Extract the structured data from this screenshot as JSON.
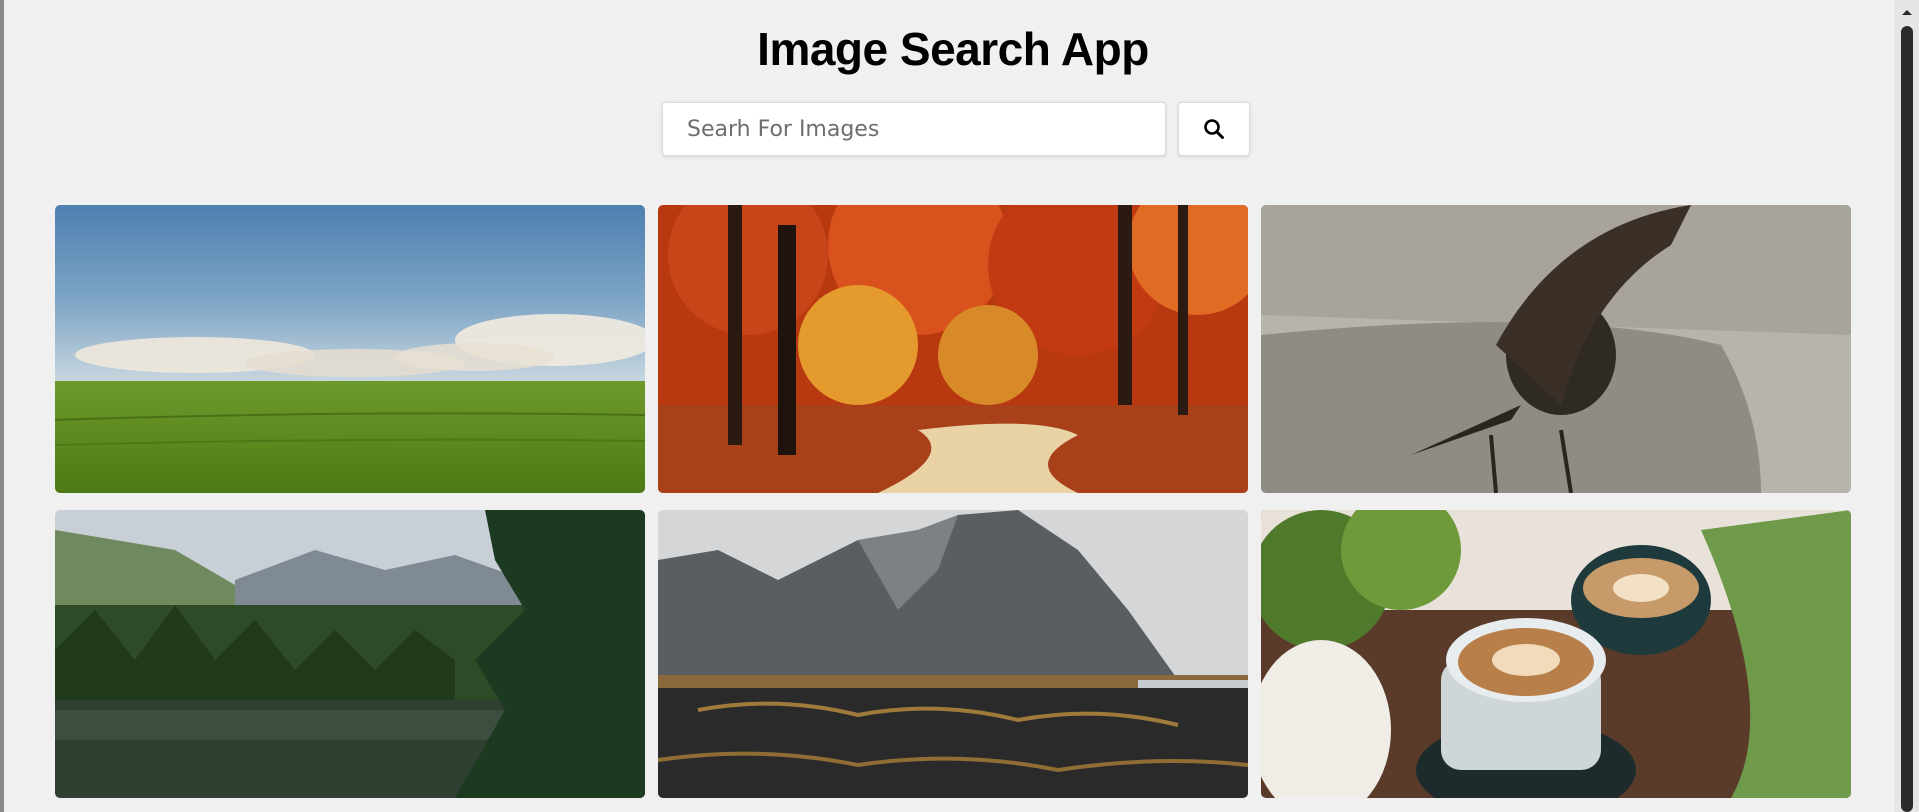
{
  "app": {
    "title": "Image Search App"
  },
  "search": {
    "placeholder": "Searh For Images",
    "value": "",
    "button_icon": "search-icon"
  },
  "results": [
    {
      "icon": "green-field-image"
    },
    {
      "icon": "autumn-forest-path-image"
    },
    {
      "icon": "starling-bird-image"
    },
    {
      "icon": "mountain-lake-forest-image"
    },
    {
      "icon": "black-sand-mountain-image"
    },
    {
      "icon": "coffee-cups-plants-image"
    }
  ],
  "scrollbar": {
    "icon": "scroll-up-arrow-icon"
  }
}
